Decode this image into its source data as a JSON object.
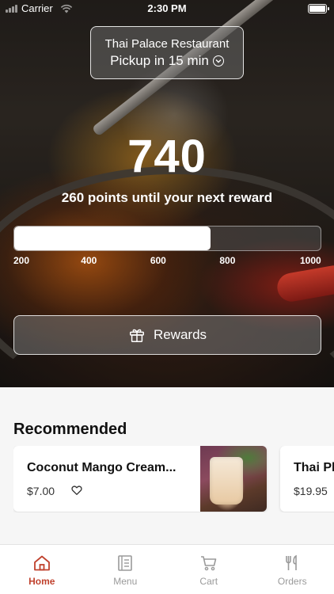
{
  "status_bar": {
    "carrier": "Carrier",
    "time": "2:30 PM"
  },
  "restaurant": {
    "name": "Thai Palace Restaurant",
    "pickup": "Pickup in 15 min"
  },
  "loyalty": {
    "points": "740",
    "caption": "260 points until your next reward",
    "progress_fraction": 0.64,
    "scale": [
      "200",
      "400",
      "600",
      "800",
      "1000"
    ],
    "rewards_label": "Rewards"
  },
  "recommended": {
    "title": "Recommended",
    "items": [
      {
        "name": "Coconut Mango Cream...",
        "price": "$7.00"
      },
      {
        "name": "Thai Ph",
        "price": "$19.95"
      }
    ]
  },
  "tabs": [
    {
      "label": "Home",
      "icon": "home-icon",
      "active": true
    },
    {
      "label": "Menu",
      "icon": "menu-icon",
      "active": false
    },
    {
      "label": "Cart",
      "icon": "cart-icon",
      "active": false
    },
    {
      "label": "Orders",
      "icon": "orders-icon",
      "active": false
    }
  ],
  "colors": {
    "accent": "#c0422e",
    "inactive": "#9a9a9a"
  }
}
